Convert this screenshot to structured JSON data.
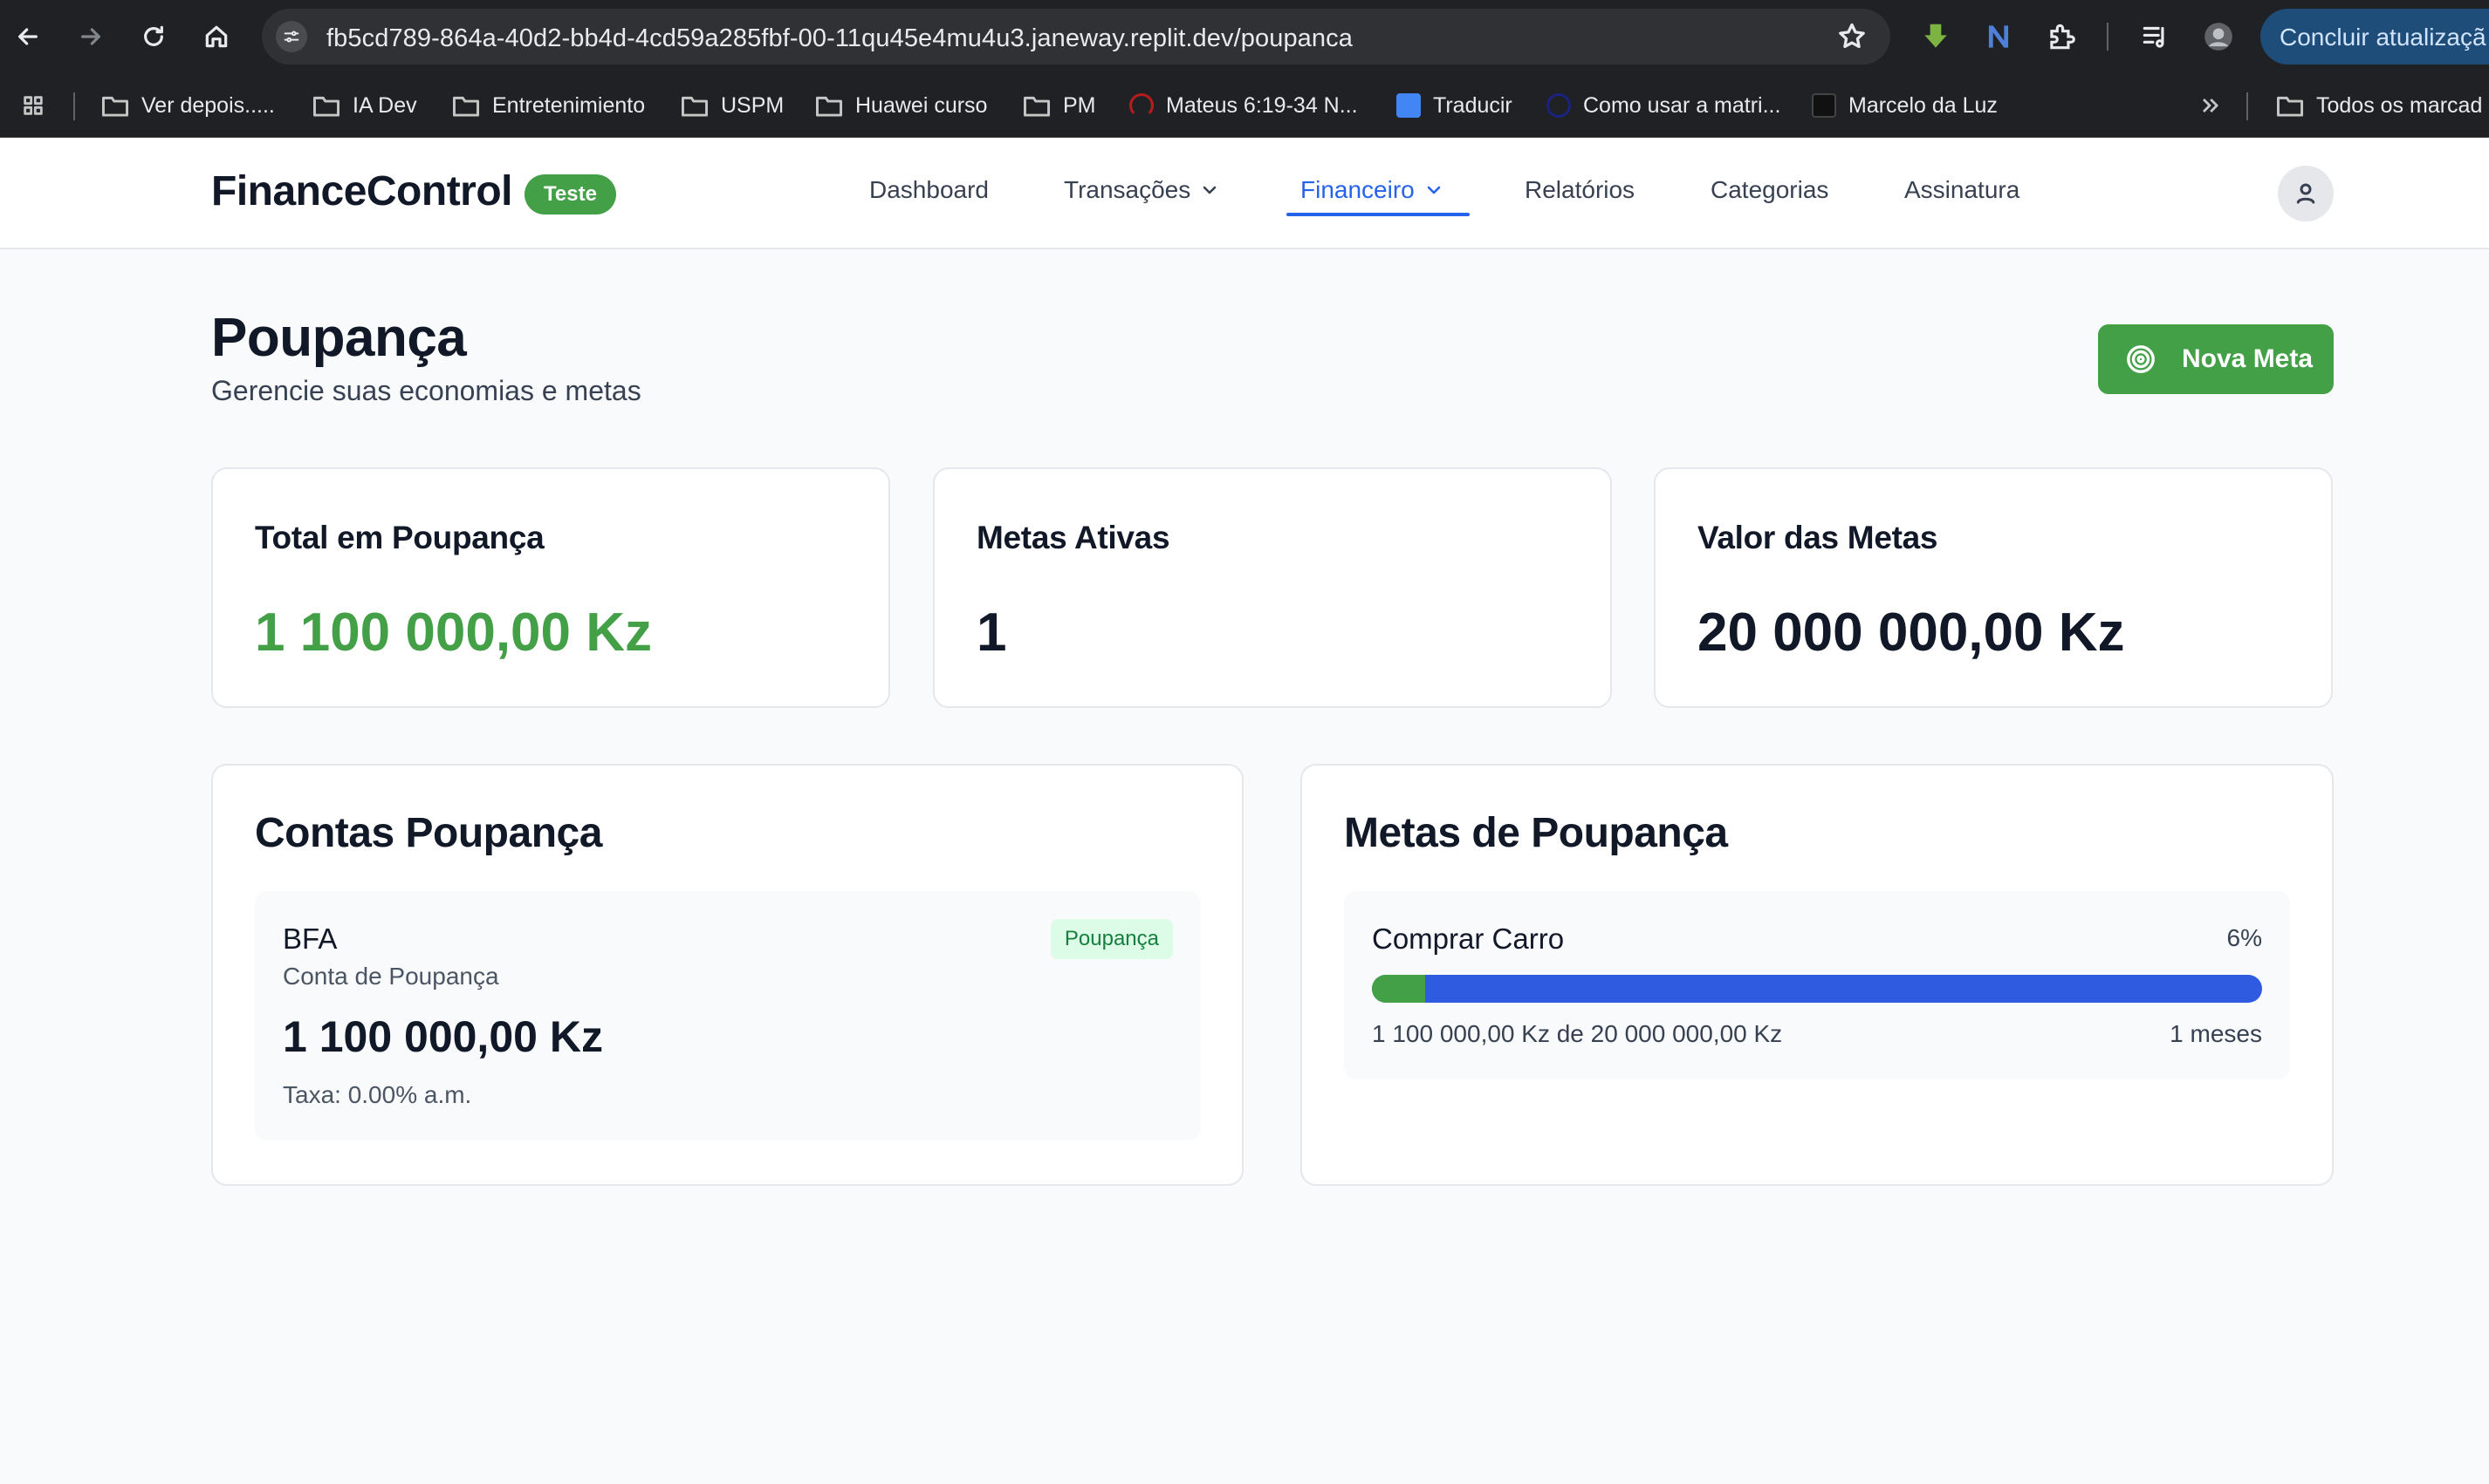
{
  "browser": {
    "url": "fb5cd789-864a-40d2-bb4d-4cd59a285fbf-00-11qu45e4mu4u3.janeway.replit.dev/poupanca",
    "update_button": "Concluir atualizaçã",
    "bookmarks": [
      {
        "label": "Ver depois.....",
        "icon": "folder-icon"
      },
      {
        "label": "IA Dev",
        "icon": "folder-icon"
      },
      {
        "label": "Entretenimiento",
        "icon": "folder-icon"
      },
      {
        "label": "USPM",
        "icon": "folder-icon"
      },
      {
        "label": "Huawei curso",
        "icon": "folder-icon"
      },
      {
        "label": "PM",
        "icon": "folder-icon"
      },
      {
        "label": "Mateus 6:19-34 N...",
        "icon": "site-favicon"
      },
      {
        "label": "Traducir",
        "icon": "translate-favicon"
      },
      {
        "label": "Como usar a matri...",
        "icon": "site-favicon"
      },
      {
        "label": "Marcelo da Luz",
        "icon": "site-favicon"
      }
    ],
    "other_bookmarks": "Todos os marcad"
  },
  "app": {
    "brand": "FinanceControl",
    "env_badge": "Teste",
    "nav": {
      "dashboard": "Dashboard",
      "transactions": "Transações",
      "financial": "Financeiro",
      "reports": "Relatórios",
      "categories": "Categorias",
      "subscription": "Assinatura"
    }
  },
  "page": {
    "title": "Poupança",
    "subtitle": "Gerencie suas economias e metas",
    "new_goal_button": "Nova Meta"
  },
  "stats": {
    "total": {
      "label": "Total em Poupança",
      "value": "1 100 000,00 Kz"
    },
    "active_goals": {
      "label": "Metas Ativas",
      "value": "1"
    },
    "goals_value": {
      "label": "Valor das Metas",
      "value": "20 000 000,00 Kz"
    }
  },
  "accounts_section": {
    "title": "Contas Poupança",
    "accounts": [
      {
        "name": "BFA",
        "type": "Conta de Poupança",
        "badge": "Poupança",
        "balance": "1 100 000,00 Kz",
        "rate": "Taxa: 0.00% a.m."
      }
    ]
  },
  "goals_section": {
    "title": "Metas de Poupança",
    "goals": [
      {
        "name": "Comprar Carro",
        "percent_label": "6%",
        "progress": 0.06,
        "amount": "1 100 000,00 Kz de 20 000 000,00 Kz",
        "time_left": "1 meses"
      }
    ]
  },
  "colors": {
    "accent_green": "#43a047",
    "accent_blue": "#2563eb",
    "progress_track": "#2f5be0"
  }
}
